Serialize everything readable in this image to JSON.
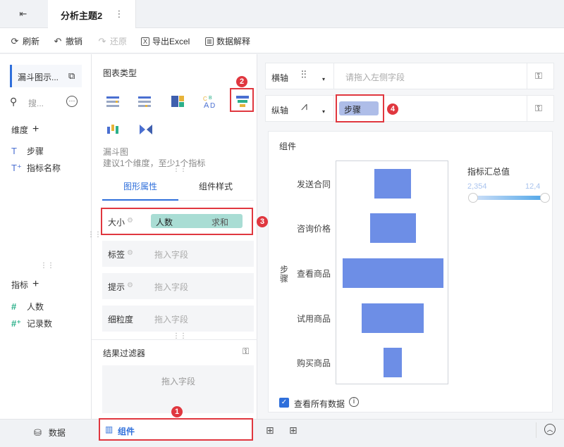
{
  "app": {
    "tab_title": "分析主题2"
  },
  "toolbar": {
    "refresh": "刷新",
    "undo": "撤销",
    "redo": "还原",
    "export_excel": "导出Excel",
    "data_explain": "数据解释"
  },
  "left_panel": {
    "dataset_name": "漏斗图示...",
    "search_placeholder": "搜...",
    "dimensions_title": "维度",
    "dimensions": [
      {
        "label": "步骤"
      },
      {
        "label": "指标名称"
      }
    ],
    "measures_title": "指标",
    "measures": [
      {
        "label": "人数"
      },
      {
        "label": "记录数"
      }
    ]
  },
  "middle_panel": {
    "chart_type_title": "图表类型",
    "chart_desc_name": "漏斗图",
    "chart_desc_hint": "建议1个维度，至少1个指标",
    "tabs": [
      {
        "label": "图形属性"
      },
      {
        "label": "组件样式"
      }
    ],
    "attributes": {
      "size": {
        "label": "大小",
        "field": "人数",
        "agg": "求和"
      },
      "label": {
        "label": "标签",
        "placeholder": "拖入字段"
      },
      "tooltip": {
        "label": "提示",
        "placeholder": "拖入字段"
      },
      "granularity": {
        "label": "细粒度",
        "placeholder": "拖入字段"
      }
    },
    "filter_title": "结果过滤器",
    "filter_placeholder": "拖入字段"
  },
  "right_panel": {
    "x_axis_label": "横轴",
    "x_axis_placeholder": "请拖入左侧字段",
    "y_axis_label": "纵轴",
    "y_axis_field": "步骤",
    "chart_title": "组件",
    "show_all_data": "查看所有数据"
  },
  "annotations": {
    "b1": "1",
    "b2": "2",
    "b3": "3",
    "b4": "4"
  },
  "bottom_bar": {
    "data_tab": "数据",
    "component_tab": "组件"
  },
  "colors": {
    "accent": "#2f6fdb",
    "bar": "#6d8ee6",
    "highlight": "#e0373f",
    "pill_measure": "#a9ddd4",
    "pill_dim": "#aebde8"
  },
  "chart_data": {
    "type": "bar",
    "orientation": "funnel",
    "ylabel": "步骤",
    "categories": [
      "发送合同",
      "咨询价格",
      "查看商品",
      "试用商品",
      "购买商品"
    ],
    "values": [
      1000,
      1250,
      2750,
      1700,
      500
    ],
    "legend": {
      "title": "指标汇总值",
      "min": "2,354",
      "max": "12,4"
    }
  }
}
